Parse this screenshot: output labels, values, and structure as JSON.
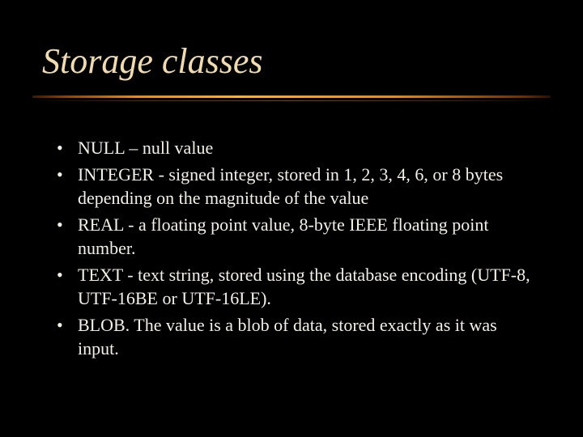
{
  "slide": {
    "title": "Storage classes",
    "bullets": [
      "NULL – null value",
      "INTEGER - signed integer, stored in 1, 2, 3, 4, 6, or 8 bytes depending on the magnitude of the value",
      "REAL - a floating point value, 8-byte IEEE floating point number.",
      "TEXT - text string, stored using the database encoding (UTF-8, UTF-16BE or UTF-16LE).",
      "BLOB. The value is a blob of data, stored exactly as it was input."
    ]
  }
}
